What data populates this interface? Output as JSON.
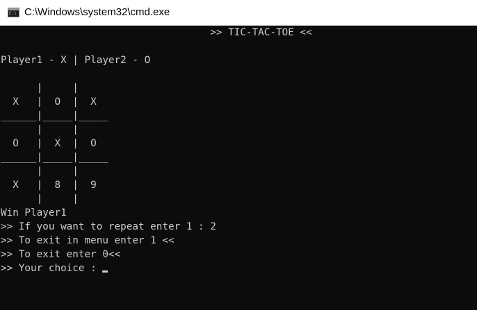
{
  "window": {
    "title": "C:\\Windows\\system32\\cmd.exe",
    "icon": "cmd-icon",
    "icon_label": "C:\\"
  },
  "console": {
    "lines": [
      "                                   >> TIC-TAC-TOE <<",
      "",
      "Player1 - X | Player2 - O",
      "",
      "      |     |",
      "  X   |  O  |  X",
      "______|_____|_____",
      "      |     |",
      "  O   |  X  |  O",
      "______|_____|_____",
      "      |     |",
      "  X   |  8  |  9",
      "      |     |",
      "Win Player1",
      ">> If you want to repeat enter 1 : 2",
      ">> To exit in menu enter 1 <<",
      ">> To exit enter 0<<",
      ">> Your choice : "
    ]
  },
  "colors": {
    "background": "#0c0c0c",
    "text": "#cccccc",
    "titlebar": "#ffffff"
  }
}
